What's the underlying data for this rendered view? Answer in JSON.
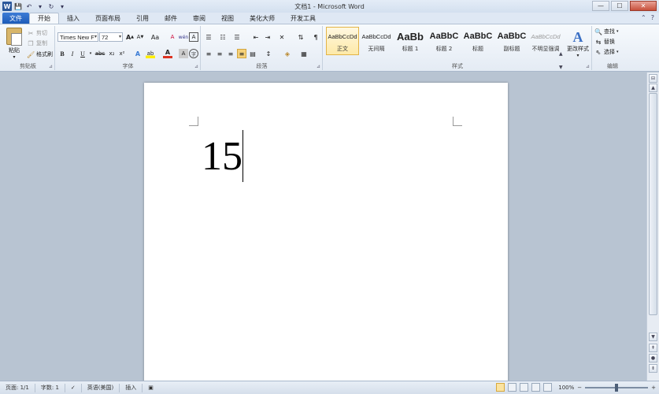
{
  "window": {
    "title": "文档1 - Microsoft Word",
    "app_icon": "W"
  },
  "quick_access": [
    {
      "icon": "save-icon",
      "glyph": "💾"
    },
    {
      "icon": "undo-icon",
      "glyph": "↶"
    },
    {
      "icon": "dropdown-arrow-icon",
      "glyph": "▾"
    },
    {
      "icon": "repeat-icon",
      "glyph": "↻"
    },
    {
      "icon": "customize-arrow-icon",
      "glyph": "▾"
    }
  ],
  "window_controls": {
    "minimize": "—",
    "maximize": "☐",
    "close": "✕"
  },
  "tabs": {
    "file": "文件",
    "items": [
      "开始",
      "插入",
      "页面布局",
      "引用",
      "邮件",
      "审阅",
      "视图",
      "美化大师",
      "开发工具"
    ],
    "active_index": 0
  },
  "ribbon": {
    "clipboard": {
      "label": "剪贴板",
      "paste": "粘贴",
      "cut": "剪切",
      "copy": "复制",
      "format_painter": "格式刷"
    },
    "font": {
      "label": "字体",
      "font_name": "Times New F",
      "font_size": "72",
      "grow": "A",
      "shrink": "A",
      "case": "Aa",
      "clear": "A",
      "bold": "B",
      "italic": "I",
      "underline": "U",
      "strike": "abc",
      "subscript": "x₂",
      "superscript": "x²",
      "effects": "A",
      "highlight": "ab",
      "font_color": "A",
      "shading": "A",
      "border": "A",
      "phonetic": "wén",
      "enclose": "字"
    },
    "paragraph": {
      "label": "段落"
    },
    "styles": {
      "label": "样式",
      "items": [
        {
          "sample": "AaBbCcDd",
          "name": "正文",
          "size": 7.5,
          "bold": false,
          "color": "#222"
        },
        {
          "sample": "AaBbCcDd",
          "name": "无间隔",
          "size": 7.5,
          "bold": false,
          "color": "#222"
        },
        {
          "sample": "AaBb",
          "name": "标题 1",
          "size": 13,
          "bold": true,
          "color": "#222"
        },
        {
          "sample": "AaBbC",
          "name": "标题 2",
          "size": 11,
          "bold": true,
          "color": "#222"
        },
        {
          "sample": "AaBbC",
          "name": "标题",
          "size": 11,
          "bold": true,
          "color": "#222"
        },
        {
          "sample": "AaBbC",
          "name": "副标题",
          "size": 11,
          "bold": true,
          "color": "#222"
        },
        {
          "sample": "AaBbCcDd",
          "name": "不明显强调",
          "size": 7.5,
          "bold": false,
          "color": "#999"
        }
      ],
      "change_styles": "更改样式"
    },
    "editing": {
      "label": "编辑",
      "find": "查找",
      "replace": "替换",
      "select": "选择"
    }
  },
  "document": {
    "content": "15"
  },
  "status_bar": {
    "page": "页面: 1/1",
    "words": "字数: 1",
    "language": "英语(美国)",
    "mode": "插入",
    "zoom": "100%",
    "zoom_minus": "−",
    "zoom_plus": "+"
  }
}
